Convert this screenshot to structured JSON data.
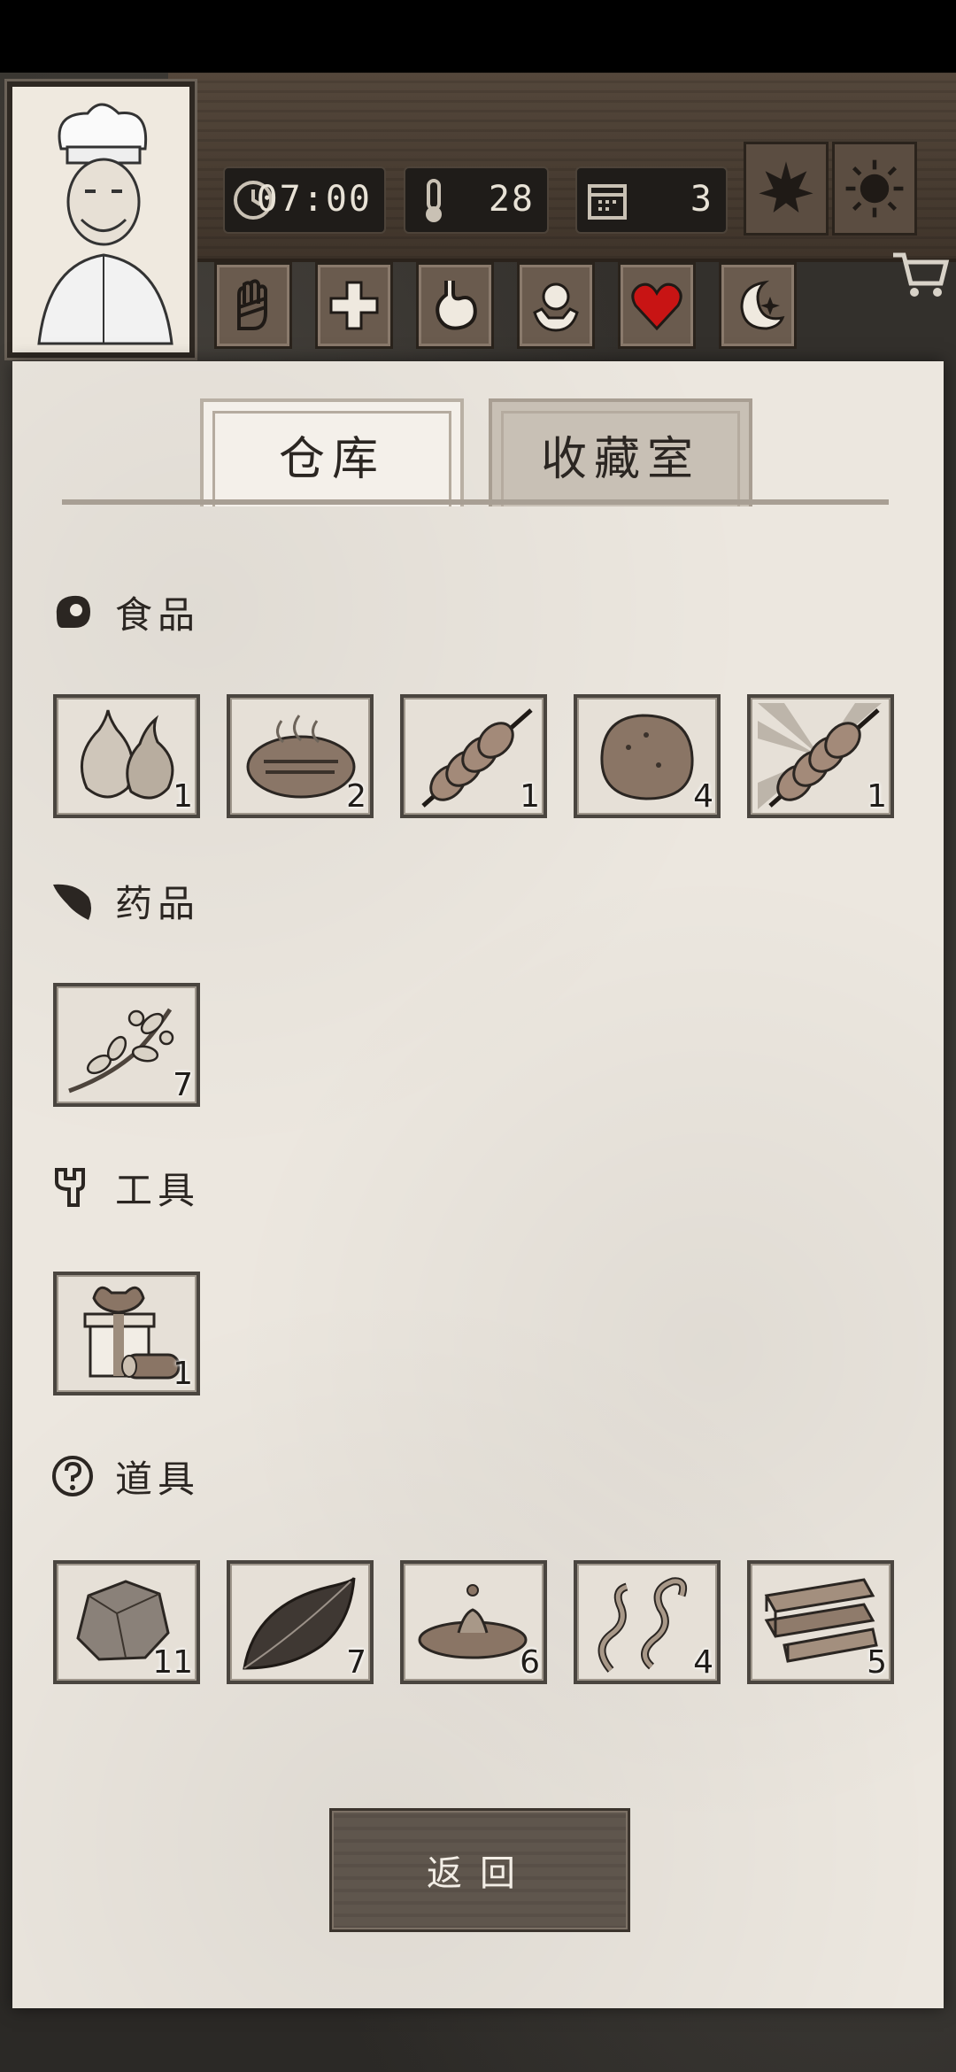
{
  "hud": {
    "time": "07:00",
    "temperature": "28",
    "day": "3"
  },
  "tabs": {
    "warehouse": "仓库",
    "collection": "收藏室"
  },
  "sections": {
    "food": {
      "label": "食品",
      "items": [
        {
          "icon": "onion-icon",
          "count": "1"
        },
        {
          "icon": "grilled-steak-icon",
          "count": "2"
        },
        {
          "icon": "skewer-icon",
          "count": "1"
        },
        {
          "icon": "potato-icon",
          "count": "4"
        },
        {
          "icon": "skewer-highlighted-icon",
          "count": "1"
        }
      ]
    },
    "medicine": {
      "label": "药品",
      "items": [
        {
          "icon": "herb-branch-icon",
          "count": "7"
        }
      ]
    },
    "tools": {
      "label": "工具",
      "items": [
        {
          "icon": "gift-box-log-icon",
          "count": "1"
        }
      ]
    },
    "props": {
      "label": "道具",
      "items": [
        {
          "icon": "stone-icon",
          "count": "11"
        },
        {
          "icon": "leaf-icon",
          "count": "7"
        },
        {
          "icon": "water-puddle-icon",
          "count": "6"
        },
        {
          "icon": "worms-icon",
          "count": "4"
        },
        {
          "icon": "wood-planks-icon",
          "count": "5"
        }
      ]
    }
  },
  "back_button": "返回",
  "colors": {
    "paper": "#ece7df",
    "wood": "#54473b",
    "heart": "#c81414"
  }
}
